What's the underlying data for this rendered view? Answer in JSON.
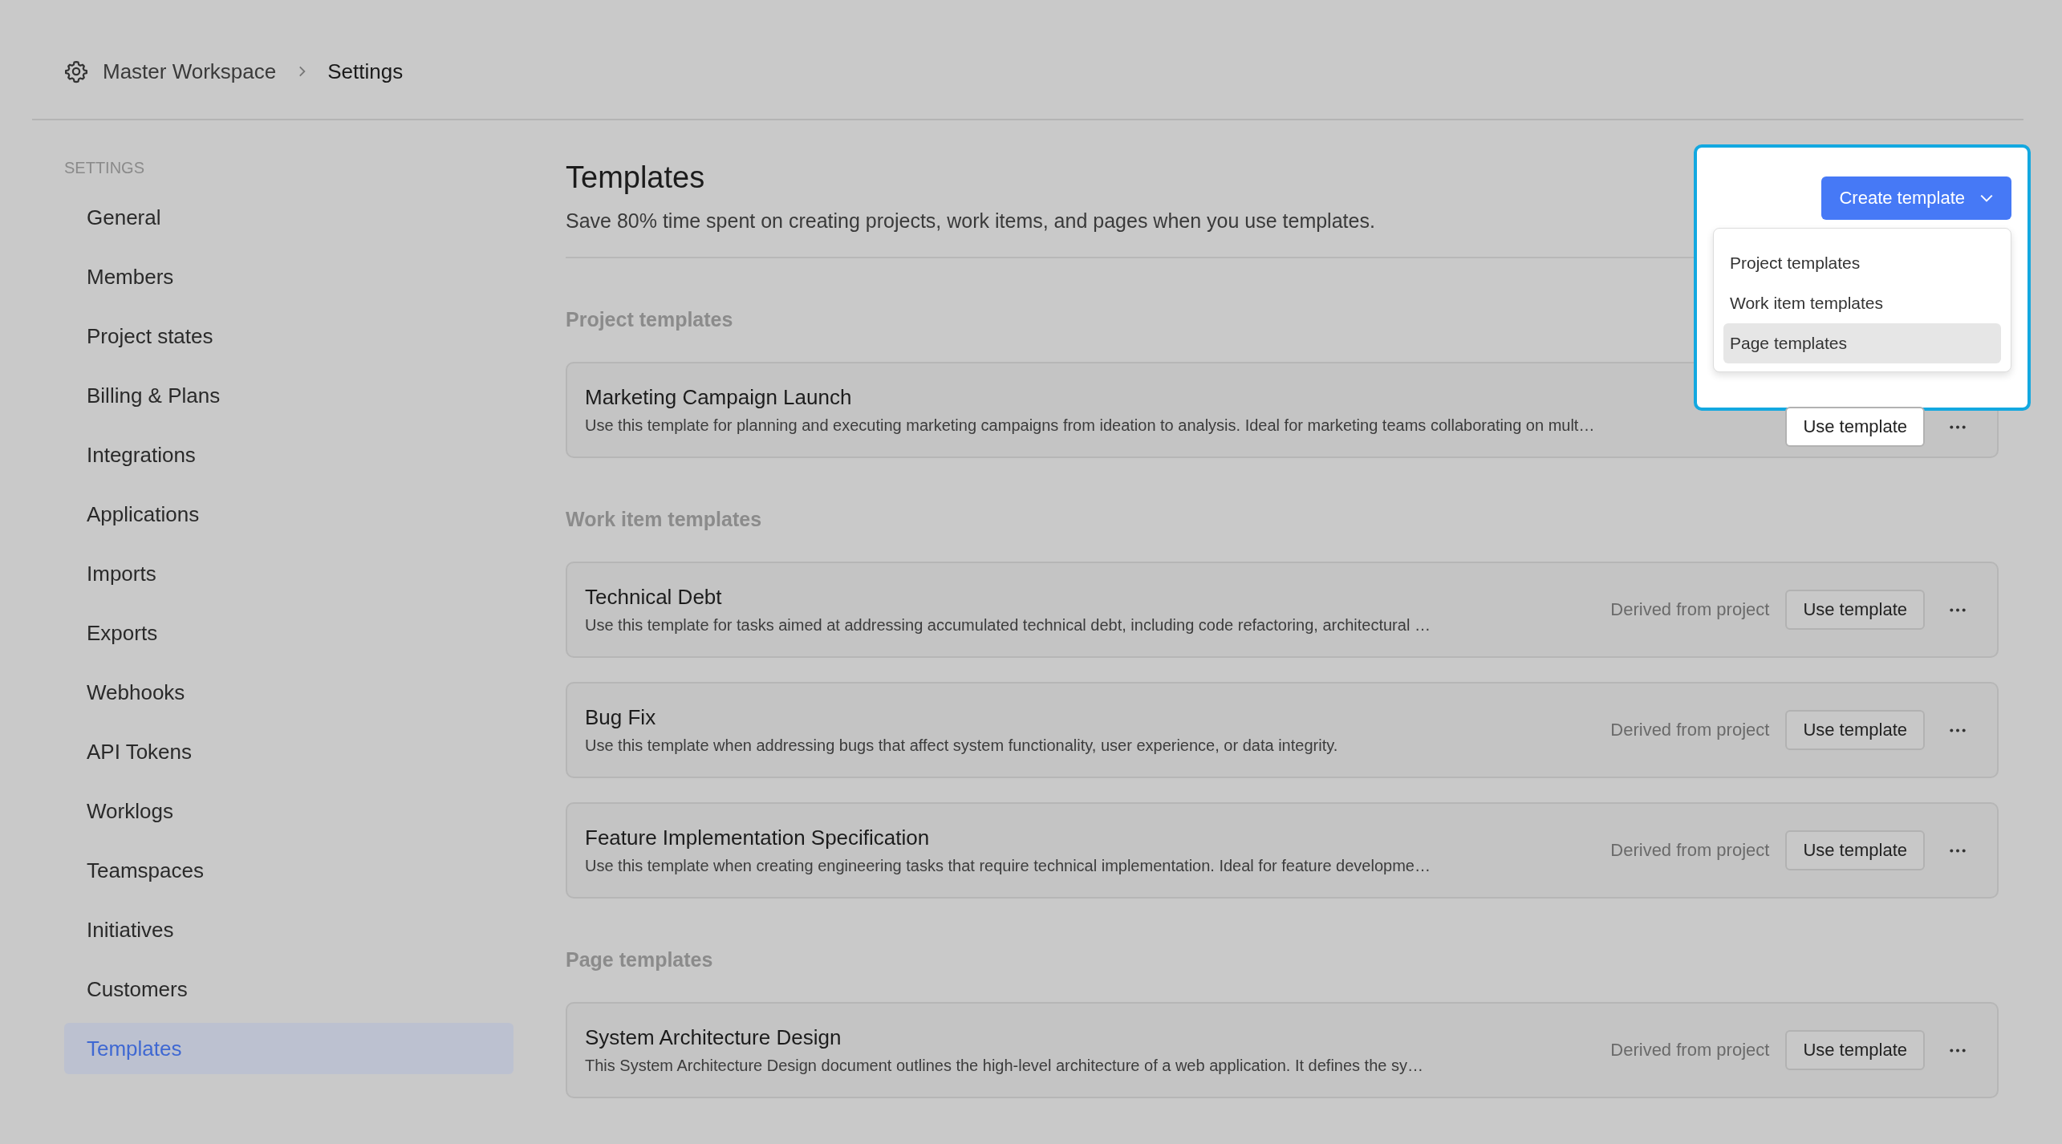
{
  "breadcrumb": {
    "workspace": "Master Workspace",
    "current": "Settings"
  },
  "sidebar": {
    "heading": "SETTINGS",
    "items": [
      {
        "label": "General",
        "selected": false
      },
      {
        "label": "Members",
        "selected": false
      },
      {
        "label": "Project states",
        "selected": false
      },
      {
        "label": "Billing & Plans",
        "selected": false
      },
      {
        "label": "Integrations",
        "selected": false
      },
      {
        "label": "Applications",
        "selected": false
      },
      {
        "label": "Imports",
        "selected": false
      },
      {
        "label": "Exports",
        "selected": false
      },
      {
        "label": "Webhooks",
        "selected": false
      },
      {
        "label": "API Tokens",
        "selected": false
      },
      {
        "label": "Worklogs",
        "selected": false
      },
      {
        "label": "Teamspaces",
        "selected": false
      },
      {
        "label": "Initiatives",
        "selected": false
      },
      {
        "label": "Customers",
        "selected": false
      },
      {
        "label": "Templates",
        "selected": true
      }
    ]
  },
  "page": {
    "title": "Templates",
    "subtitle": "Save 80% time spent on creating projects, work items, and pages when you use templates."
  },
  "create_button": {
    "label": "Create template",
    "menu": [
      {
        "label": "Project templates",
        "selected": false
      },
      {
        "label": "Work item templates",
        "selected": false
      },
      {
        "label": "Page templates",
        "selected": true
      }
    ]
  },
  "sections": [
    {
      "title": "Project templates",
      "templates": [
        {
          "name": "Marketing Campaign Launch",
          "description": "Use this template for planning and executing marketing campaigns from ideation to analysis. Ideal for marketing teams collaborating on mult…",
          "action": "Use template"
        }
      ]
    },
    {
      "title": "Work item templates",
      "templates": [
        {
          "name": "Technical Debt",
          "description": "Use this template for tasks aimed at addressing accumulated technical debt, including code refactoring, architectural …",
          "source": "Derived from project",
          "action": "Use template"
        },
        {
          "name": "Bug Fix",
          "description": "Use this template when addressing bugs that affect system functionality, user experience, or data integrity.",
          "source": "Derived from project",
          "action": "Use template"
        },
        {
          "name": "Feature Implementation Specification",
          "description": "Use this template when creating engineering tasks that require technical implementation. Ideal for feature developme…",
          "source": "Derived from project",
          "action": "Use template"
        }
      ]
    },
    {
      "title": "Page templates",
      "templates": [
        {
          "name": "System Architecture Design",
          "description": "This System Architecture Design document outlines the high-level architecture of a web application. It defines the sy…",
          "source": "Derived from project",
          "action": "Use template"
        }
      ]
    }
  ]
}
